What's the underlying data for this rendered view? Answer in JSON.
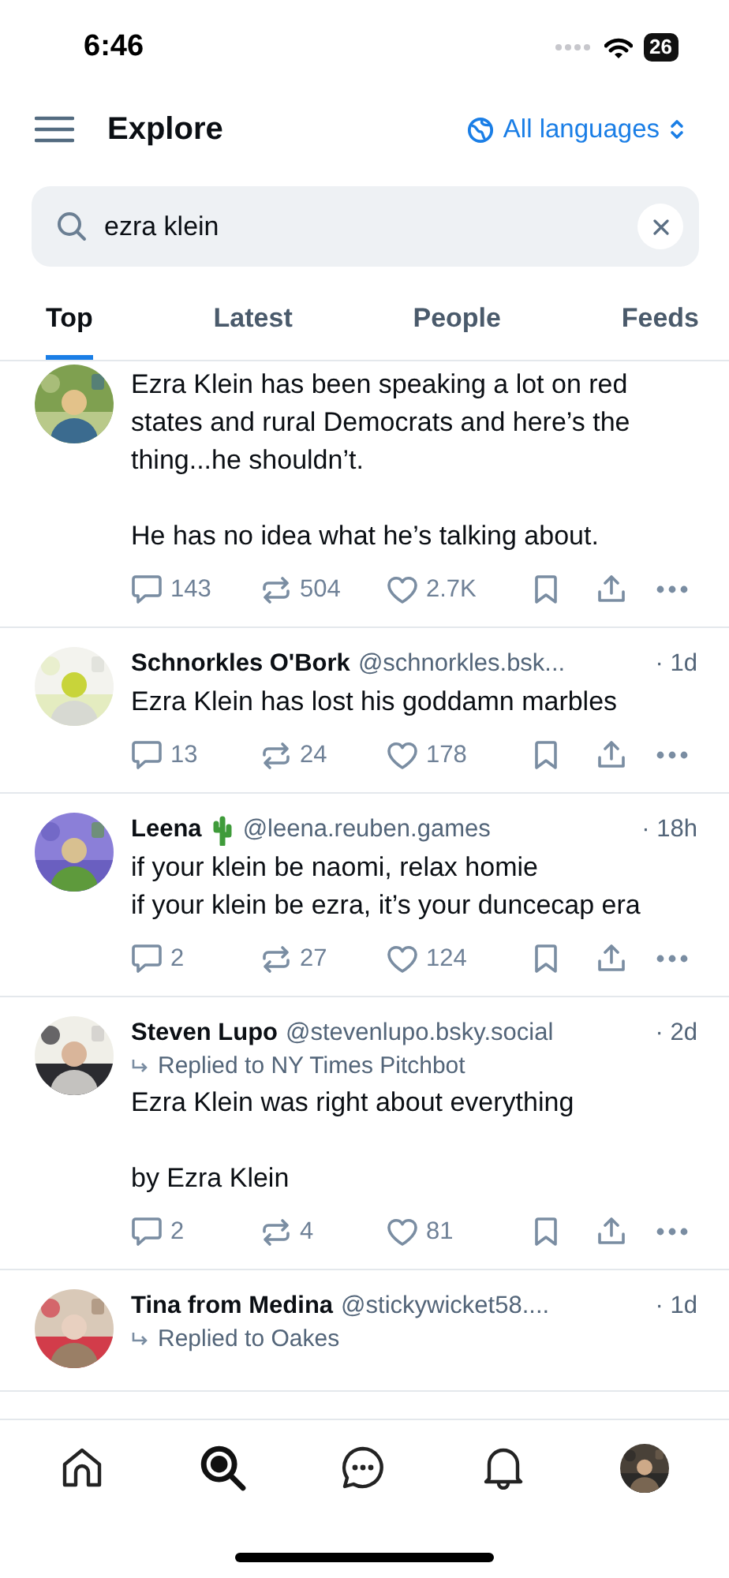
{
  "status_bar": {
    "time": "6:46",
    "battery": "26"
  },
  "header": {
    "title": "Explore",
    "language": "All languages"
  },
  "search": {
    "value": "ezra klein"
  },
  "tabs": [
    {
      "label": "Top",
      "selected": true
    },
    {
      "label": "Latest",
      "selected": false
    },
    {
      "label": "People",
      "selected": false
    },
    {
      "label": "Feeds",
      "selected": false
    }
  ],
  "posts": [
    {
      "text": "Ezra Klein has been speaking a lot on red states and rural Democrats and here’s the thing...he shouldn’t.\n\nHe has no idea what he’s talking about.",
      "replies": "143",
      "reposts": "504",
      "likes": "2.7K"
    },
    {
      "name": "Schnorkles O'Bork",
      "badge": false,
      "handle": "@schnorkles.bsk...",
      "time": "· 1d",
      "text": "Ezra Klein has lost his goddamn marbles",
      "replies": "13",
      "reposts": "24",
      "likes": "178"
    },
    {
      "name": "Leena",
      "badge": true,
      "handle": "@leena.reuben.games",
      "time": "· 18h",
      "text": "if your klein be naomi, relax homie\nif your klein be ezra, it’s your duncecap era",
      "replies": "2",
      "reposts": "27",
      "likes": "124"
    },
    {
      "name": "Steven Lupo",
      "badge": false,
      "handle": "@stevenlupo.bsky.social",
      "time": "· 2d",
      "reply_to": "Replied to NY Times Pitchbot",
      "text": "Ezra Klein was right about everything\n\nby Ezra Klein",
      "replies": "2",
      "reposts": "4",
      "likes": "81"
    },
    {
      "name": "Tina from Medina",
      "badge": false,
      "handle": "@stickywicket58....",
      "time": "· 1d",
      "reply_to": "Replied to Oakes"
    }
  ],
  "nav": [
    {
      "kind": "home",
      "selected": false
    },
    {
      "kind": "search",
      "selected": true
    },
    {
      "kind": "chat",
      "selected": false
    },
    {
      "kind": "notifications",
      "selected": false
    },
    {
      "kind": "profile",
      "selected": false
    }
  ]
}
